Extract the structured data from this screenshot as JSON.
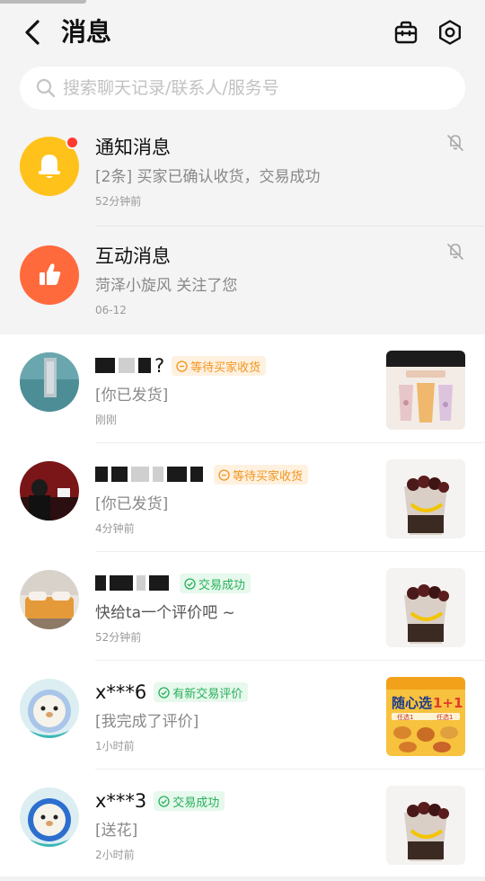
{
  "header": {
    "title": "消息",
    "back_icon": "back-arrow-icon",
    "actions": [
      "bag-icon",
      "settings-icon"
    ]
  },
  "search": {
    "placeholder": "搜索聊天记录/联系人/服务号",
    "icon": "search-icon"
  },
  "system_messages": [
    {
      "name": "通知消息",
      "preview": "[2条] 买家已确认收货，交易成功",
      "time": "52分钟前",
      "icon": "bell-icon",
      "color": "#ffc21a",
      "unread_dot": true,
      "muted": true
    },
    {
      "name": "互动消息",
      "preview": "菏泽小旋风 关注了您",
      "time": "06-12",
      "icon": "thumbs-up-icon",
      "color": "#ff6a3d",
      "unread_dot": false,
      "muted": true
    }
  ],
  "chats": [
    {
      "name": "?",
      "badge": "等待买家收货",
      "badge_type": "orange",
      "preview": "[你已发货]",
      "time": "刚刚"
    },
    {
      "name": "",
      "badge": "等待买家收货",
      "badge_type": "orange",
      "preview": "[你已发货]",
      "time": "4分钟前"
    },
    {
      "name": "",
      "badge": "交易成功",
      "badge_type": "green",
      "preview": "快给ta一个评价吧 ~",
      "time": "52分钟前"
    },
    {
      "name": "x***6",
      "badge": "有新交易评价",
      "badge_type": "green",
      "preview": "[我完成了评价]",
      "time": "1小时前"
    },
    {
      "name": "x***3",
      "badge": "交易成功",
      "badge_type": "green",
      "preview": "[送花]",
      "time": "2小时前"
    }
  ],
  "thumb_texts": {
    "promo_title": "随心选",
    "promo_price": "1+1",
    "promo_tag": "任选1"
  },
  "colors": {
    "orange_badge": "#f0961e",
    "green_badge": "#28b15d",
    "bell_yellow": "#ffc21a",
    "thumb_red": "#ff6a3d"
  }
}
